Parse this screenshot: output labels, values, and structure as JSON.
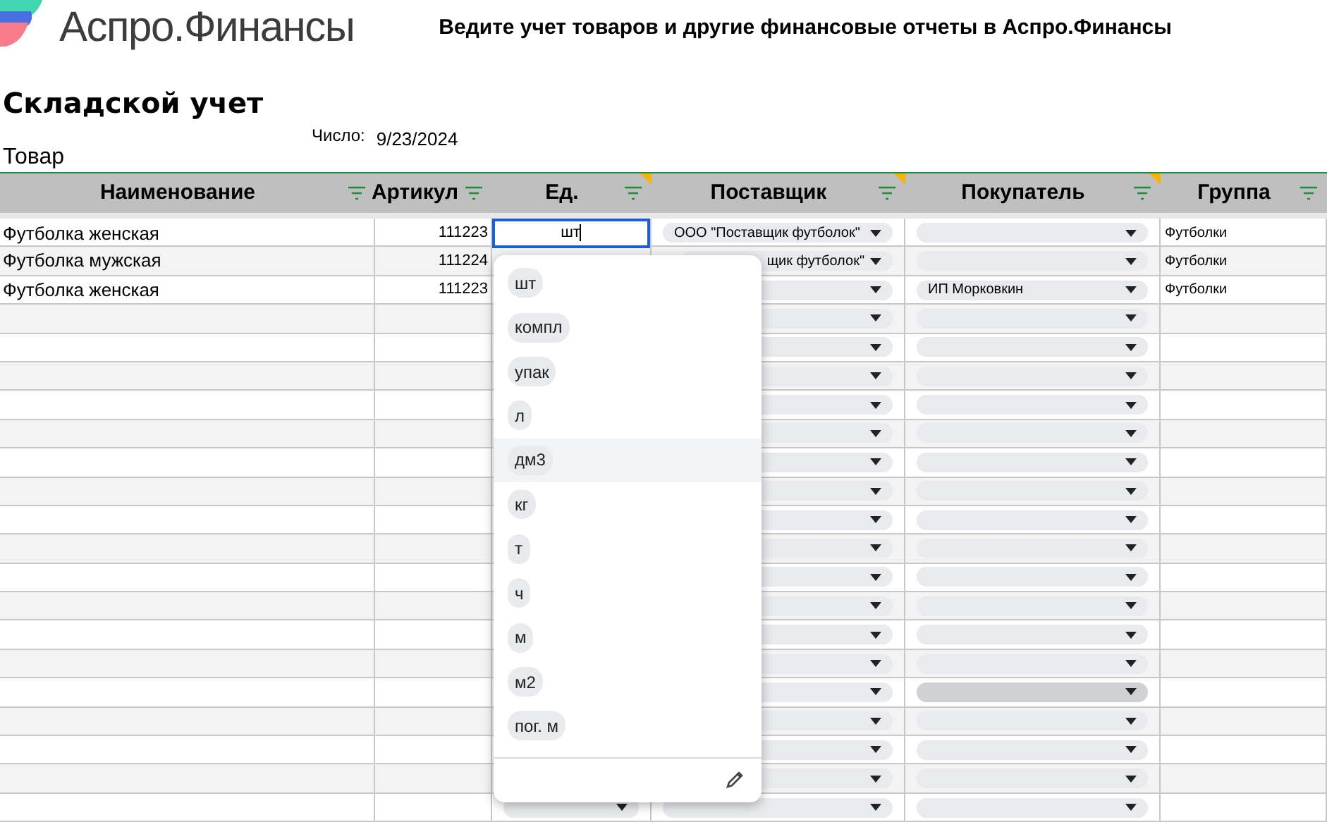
{
  "brand": {
    "name": "Аспро.Финансы"
  },
  "banner": "Ведите учет товаров и другие финансовые отчеты в Аспро.Финансы",
  "title": "Складской учет",
  "date": {
    "label": "Число:",
    "value": "9/23/2024"
  },
  "section": "Товар",
  "table": {
    "columns": [
      {
        "label": "Наименование",
        "note": false
      },
      {
        "label": "Артикул",
        "note": false
      },
      {
        "label": "Ед.",
        "note": true
      },
      {
        "label": "Поставщик",
        "note": true
      },
      {
        "label": "Покупатель",
        "note": true
      },
      {
        "label": "Группа",
        "note": false
      }
    ],
    "rows": [
      {
        "name": "Футболка женская",
        "sku": "111223",
        "unit": {
          "kind": "editing",
          "value": "шт"
        },
        "supplier": {
          "value": "ООО \"Поставщик футболок\"",
          "clipped": false
        },
        "buyer": {
          "hovered": false
        },
        "group": "Футболки"
      },
      {
        "name": "Футболка мужская",
        "sku": "111224",
        "supplier": {
          "value": "щик футболок\"",
          "clipped": true
        },
        "buyer": {
          "hovered": false
        },
        "group": "Футболки"
      },
      {
        "name": "Футболка женская",
        "sku": "111223",
        "supplier": {
          "clipped": false
        },
        "buyer": {
          "value": "ИП Морковкин",
          "hovered": false
        },
        "group": "Футболки"
      },
      {
        "supplier": {
          "clipped": false
        },
        "buyer": {
          "hovered": false
        }
      },
      {
        "supplier": {
          "clipped": false
        },
        "buyer": {
          "hovered": false
        }
      },
      {
        "supplier": {
          "clipped": false
        },
        "buyer": {
          "hovered": false
        }
      },
      {
        "supplier": {
          "clipped": false
        },
        "buyer": {
          "hovered": false
        }
      },
      {
        "supplier": {
          "clipped": false
        },
        "buyer": {
          "hovered": false
        }
      },
      {
        "supplier": {
          "clipped": false
        },
        "buyer": {
          "hovered": false
        }
      },
      {
        "supplier": {
          "clipped": false
        },
        "buyer": {
          "hovered": false
        }
      },
      {
        "supplier": {
          "clipped": false
        },
        "buyer": {
          "hovered": false
        }
      },
      {
        "supplier": {
          "clipped": false
        },
        "buyer": {
          "hovered": false
        }
      },
      {
        "supplier": {
          "clipped": false
        },
        "buyer": {
          "hovered": false
        }
      },
      {
        "supplier": {
          "clipped": false
        },
        "buyer": {
          "hovered": false
        }
      },
      {
        "supplier": {
          "clipped": false
        },
        "buyer": {
          "hovered": false
        }
      },
      {
        "supplier": {
          "clipped": false
        },
        "buyer": {
          "hovered": false
        }
      },
      {
        "supplier": {
          "clipped": false
        },
        "buyer": {
          "hovered": true
        }
      },
      {
        "supplier": {
          "clipped": false
        },
        "buyer": {
          "hovered": false
        }
      },
      {
        "supplier": {
          "clipped": false
        },
        "buyer": {
          "hovered": false
        }
      },
      {
        "supplier": {
          "clipped": false
        },
        "buyer": {
          "hovered": false
        }
      },
      {
        "unit": {
          "kind": "dropdown"
        },
        "supplier": {
          "clipped": false
        },
        "buyer": {
          "hovered": false
        }
      }
    ]
  },
  "dropdown": {
    "options": [
      {
        "label": "шт",
        "highlighted": false
      },
      {
        "label": "компл",
        "highlighted": false
      },
      {
        "label": "упак",
        "highlighted": false
      },
      {
        "label": "л",
        "highlighted": false
      },
      {
        "label": "дм3",
        "highlighted": true
      },
      {
        "label": "кг",
        "highlighted": false
      },
      {
        "label": "т",
        "highlighted": false
      },
      {
        "label": "ч",
        "highlighted": false
      },
      {
        "label": "м",
        "highlighted": false
      },
      {
        "label": "м2",
        "highlighted": false
      },
      {
        "label": "пог. м",
        "highlighted": false
      }
    ]
  }
}
